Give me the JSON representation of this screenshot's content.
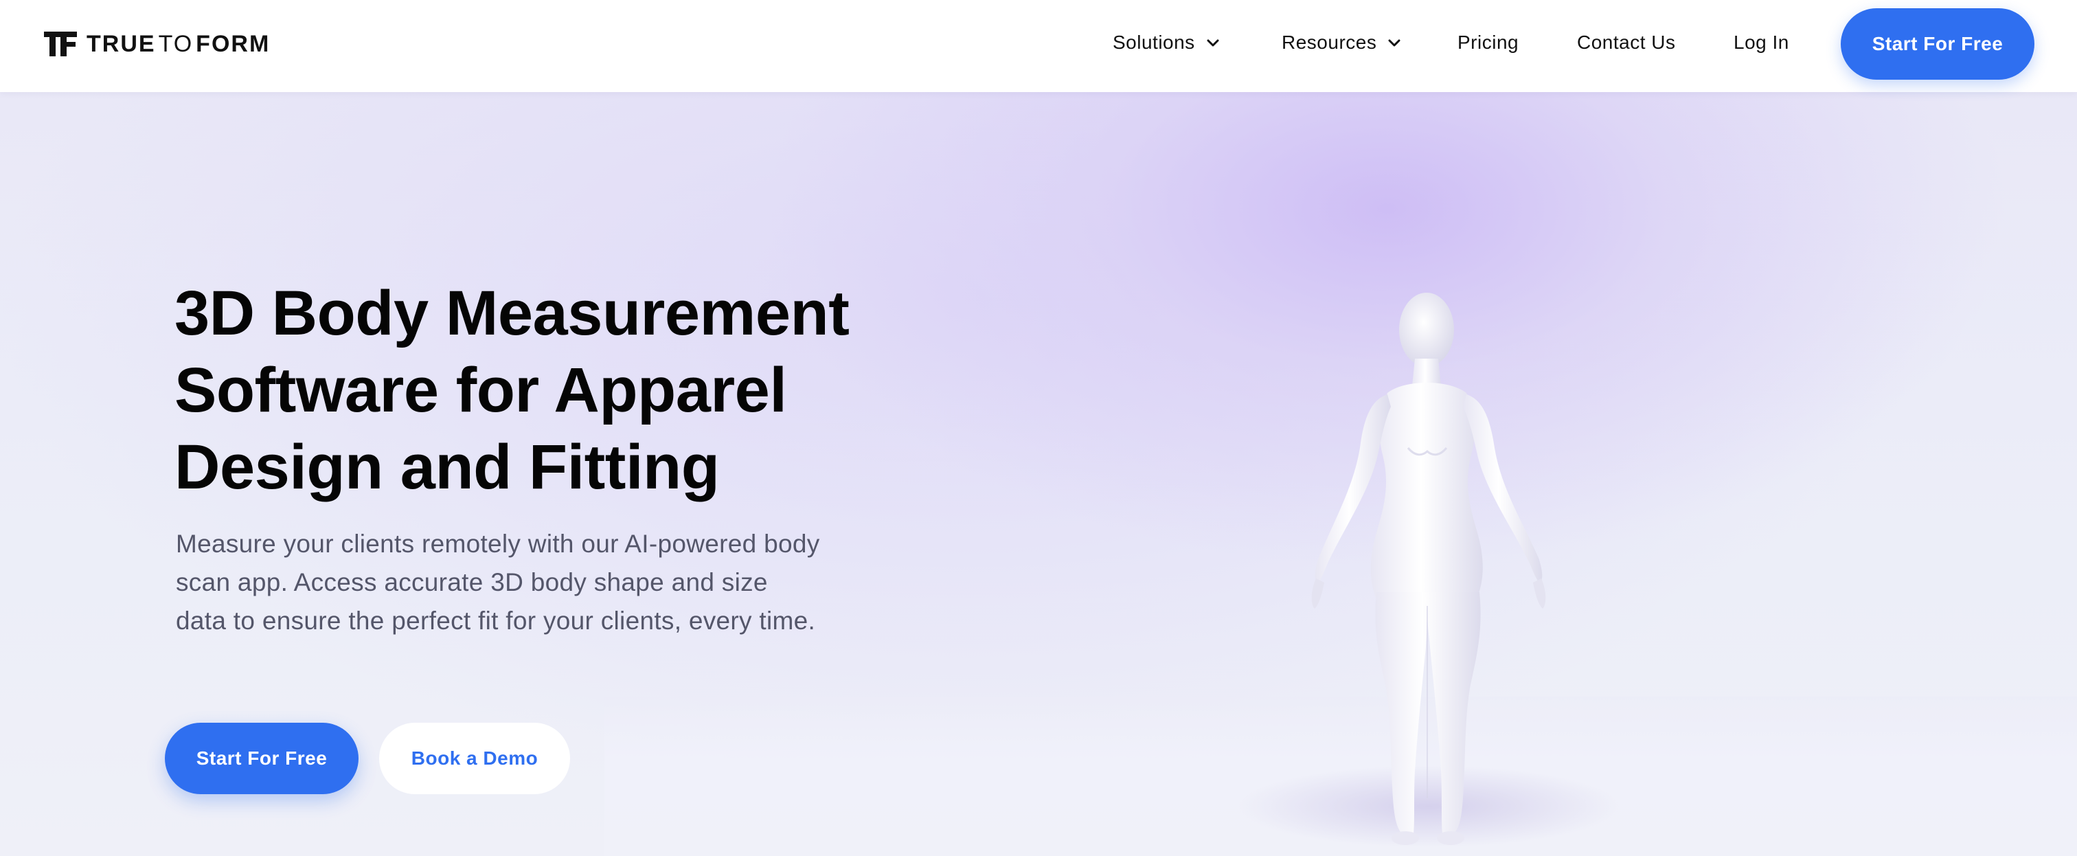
{
  "header": {
    "logo": {
      "bold1": "TRUE",
      "light": "TO",
      "bold2": "FORM"
    },
    "nav": [
      {
        "label": "Solutions",
        "dropdown": true
      },
      {
        "label": "Resources",
        "dropdown": true
      },
      {
        "label": "Pricing",
        "dropdown": false
      },
      {
        "label": "Contact Us",
        "dropdown": false
      },
      {
        "label": "Log In",
        "dropdown": false
      }
    ],
    "cta_label": "Start For Free"
  },
  "hero": {
    "title_lines": [
      "3D Body Measurement",
      "Software for Apparel",
      "Design and Fitting"
    ],
    "description": "Measure your clients remotely with our AI-powered body scan app. Access accurate 3D body shape and size data to ensure the perfect fit for your clients, every time.",
    "primary_button": "Start For Free",
    "secondary_button": "Book a Demo",
    "illustration_icon": "3d-body-model"
  },
  "colors": {
    "accent": "#2f6ff0",
    "hero_bg": "#eeeff8",
    "hero_glow": "#d6ccf5",
    "text_dark": "#050505",
    "text_muted": "#54566a"
  }
}
